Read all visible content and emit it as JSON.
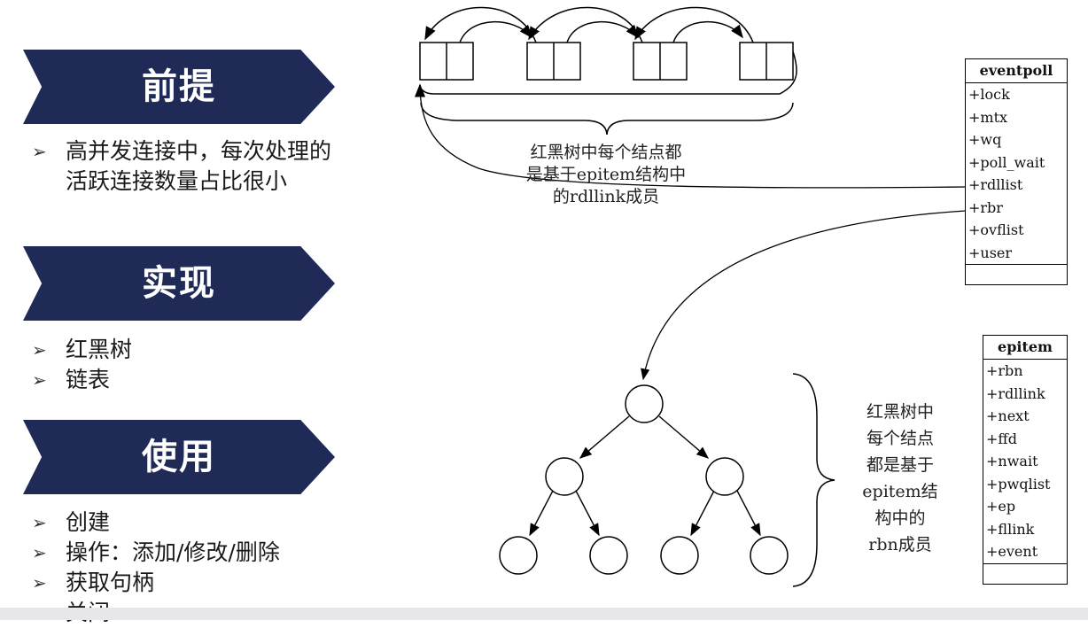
{
  "sections": [
    {
      "title": "前提",
      "bullets": [
        "高并发连接中，每次处理的活跃连接数量占比很小"
      ]
    },
    {
      "title": "实现",
      "bullets": [
        "红黑树",
        "链表"
      ]
    },
    {
      "title": "使用",
      "bullets": [
        "创建",
        "操作：添加/修改/删除",
        "获取句柄",
        "关闭"
      ]
    }
  ],
  "bullet_marker": "➢",
  "eventpoll": {
    "title": "eventpoll",
    "fields": [
      "+lock",
      "+mtx",
      "+wq",
      "+poll_wait",
      "+rdllist",
      "+rbr",
      "+ovflist",
      "+user"
    ]
  },
  "epitem": {
    "title": "epitem",
    "fields": [
      "+rbn",
      "+rdllink",
      "+next",
      "+ffd",
      "+nwait",
      "+pwqlist",
      "+ep",
      "+fllink",
      "+event"
    ]
  },
  "list_caption": [
    "红黑树中每个结点都",
    "是基于epitem结构中",
    "的rdllink成员"
  ],
  "tree_caption": [
    "红黑树中",
    "每个结点",
    "都是基于",
    "epitem结",
    "构中的",
    "rbn成员"
  ]
}
